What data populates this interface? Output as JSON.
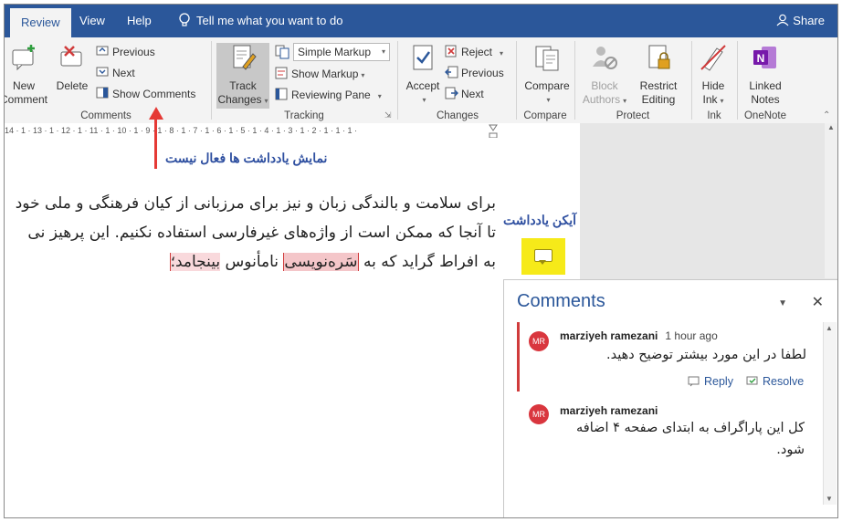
{
  "tabs": {
    "review": "Review",
    "view": "View",
    "help": "Help"
  },
  "tell_me": "Tell me what you want to do",
  "share": "Share",
  "ribbon": {
    "comments": {
      "new_line1": "New",
      "new_line2": "Comment",
      "delete": "Delete",
      "previous": "Previous",
      "next": "Next",
      "show_comments": "Show Comments",
      "group_label": "Comments"
    },
    "tracking": {
      "track_line1": "Track",
      "track_line2": "Changes",
      "markup_select": "Simple Markup",
      "show_markup": "Show Markup",
      "reviewing_pane": "Reviewing Pane",
      "group_label": "Tracking"
    },
    "changes": {
      "accept": "Accept",
      "reject": "Reject",
      "previous": "Previous",
      "next": "Next",
      "group_label": "Changes"
    },
    "compare": {
      "compare": "Compare",
      "group_label": "Compare"
    },
    "protect": {
      "block_line1": "Block",
      "block_line2": "Authors",
      "restrict_line1": "Restrict",
      "restrict_line2": "Editing",
      "group_label": "Protect"
    },
    "ink": {
      "hide_line1": "Hide",
      "hide_line2": "Ink",
      "group_label": "Ink"
    },
    "onenote": {
      "linked_line1": "Linked",
      "linked_line2": "Notes",
      "group_label": "OneNote"
    }
  },
  "ruler_text": "14 · 1 · 13 · 1 · 12 · 1 · 11 · 1 · 10 · 1 · 9 · 1 · 8 · 1 · 7 · 1 · 6 · 1 · 5 · 1 · 4 · 1 · 3 · 1 · 2 · 1 · 1 · 1 ·",
  "annotations": {
    "show_comments_inactive": "نمایش یادداشت ها فعال نیست",
    "comment_icon": "آیکن یادداشت"
  },
  "document": {
    "line1": "برای سلامت و بالندگی زبان و نیز برای مرزبانی از کیان فرهنگی و ملی خود",
    "line2": "تا آنجا که ممکن است از واژه‌های غیرفارسی استفاده نکنیم. این پرهیز نی",
    "line3_a": "به افراط گراید که به",
    "line3_hl1": "سَره‌نویسی",
    "line3_b": "نامأنوس",
    "line3_hl2": "بینجامد؛"
  },
  "comments_pane": {
    "title": "Comments",
    "threads": [
      {
        "initials": "MR",
        "author": "marziyeh ramezani",
        "time": "1 hour ago",
        "text": "لطفا در این مورد بیشتر توضیح دهید.",
        "reply": "Reply",
        "resolve": "Resolve"
      },
      {
        "initials": "MR",
        "author": "marziyeh ramezani",
        "text_line1": "کل این پاراگراف به ابتدای صفحه ۴ اضافه",
        "text_line2": "شود."
      }
    ]
  },
  "colors": {
    "accent": "#2b579a",
    "annotation": "#2e4fa0",
    "arrow": "#e53935",
    "highlight": "#f6ea19"
  }
}
